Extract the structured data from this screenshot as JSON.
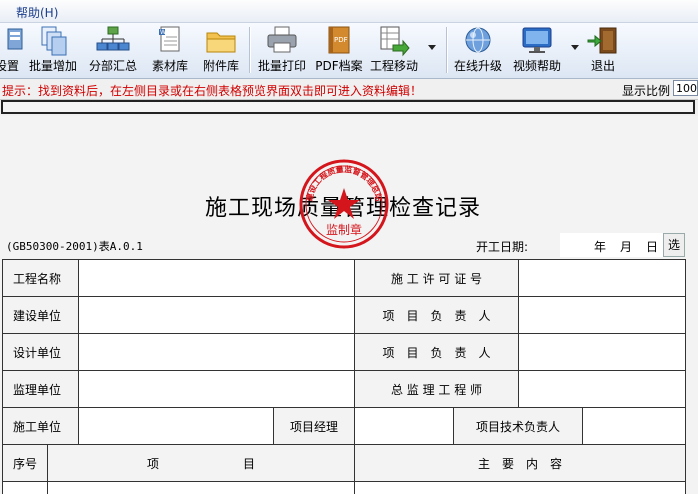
{
  "menubar": {
    "help": "帮助(H)"
  },
  "toolbar": {
    "items": [
      {
        "label": "设置",
        "icon": "settings-icon"
      },
      {
        "label": "批量增加",
        "icon": "batch-add-icon"
      },
      {
        "label": "分部汇总",
        "icon": "tree-summary-icon"
      },
      {
        "label": "素材库",
        "icon": "material-library-icon"
      },
      {
        "label": "附件库",
        "icon": "folder-icon"
      },
      {
        "label": "批量打印",
        "icon": "printer-icon"
      },
      {
        "label": "PDF档案",
        "icon": "pdf-archive-icon"
      },
      {
        "label": "工程移动",
        "icon": "project-move-icon"
      },
      {
        "label": "在线升级",
        "icon": "globe-icon"
      },
      {
        "label": "视频帮助",
        "icon": "monitor-icon"
      },
      {
        "label": "退出",
        "icon": "exit-door-icon"
      }
    ]
  },
  "tipbar": {
    "tip": "提示：找到资料后，在左侧目录或在右侧表格预览界面双击即可进入资料编辑！",
    "scale_label": "显示比例",
    "scale_value": "100"
  },
  "document": {
    "title": "施工现场质量管理检查记录",
    "seal_text": "监制章",
    "seal_arc_text": "建设工程质量监督管理总站",
    "standard_code": "(GB50300-2001)表A.0.1",
    "start_date_label": "开工日期:",
    "date_year": "年",
    "date_month": "月",
    "date_day": "日",
    "select_button": "选",
    "form": {
      "project_name": "工程名称",
      "permit_no": "施 工 许 可 证 号",
      "owner_unit": "建设单位",
      "owner_lead": "项　目　负　责　人",
      "design_unit": "设计单位",
      "design_lead": "项　目　负　责　人",
      "supervision_unit": "监理单位",
      "chief_engineer": "总 监 理 工 程 师",
      "construction_unit": "施工单位",
      "project_manager": "项目经理",
      "tech_lead": "项目技术负责人",
      "col_no": "序号",
      "col_item": "项　　　　　　　目",
      "col_content": "主　要　内　容"
    }
  },
  "colors": {
    "tip_red": "#d00000",
    "seal_red": "#d4161c",
    "menu_blue": "#1c3f8c"
  }
}
